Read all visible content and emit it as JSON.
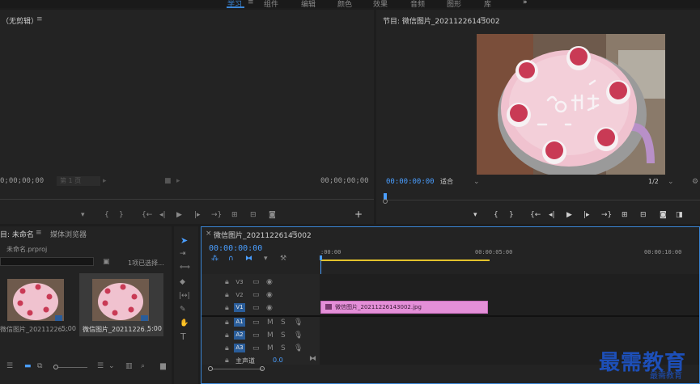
{
  "workspace": {
    "tabs": [
      {
        "label": "学习",
        "active": true
      },
      {
        "label": "组件",
        "active": false
      },
      {
        "label": "编辑",
        "active": false
      },
      {
        "label": "颜色",
        "active": false
      },
      {
        "label": "效果",
        "active": false
      },
      {
        "label": "音频",
        "active": false
      },
      {
        "label": "图形",
        "active": false
      },
      {
        "label": "库",
        "active": false
      }
    ],
    "menu_icon": "≡",
    "more_icon": "»"
  },
  "source_monitor": {
    "title": "（无剪辑）",
    "menu_icon": "≡",
    "timecode_left": "0;00;00;00",
    "timecode_right": "00;00;00;00",
    "fit_label": "第 1 页"
  },
  "program_monitor": {
    "title": "节目: 微信图片_20211226143002",
    "menu_icon": "≡",
    "timecode": "00:00:00:00",
    "fit": "适合",
    "resolution": "1/2"
  },
  "project": {
    "tab_active": "目: 未命名",
    "tab_inactive": "媒体浏览器",
    "menu_icon": "≡",
    "file": "未命名.prproj",
    "selection": "1项已选择...",
    "items": [
      {
        "name": "微信图片_20211226...",
        "duration": "5:00"
      },
      {
        "name": "微信图片_20211226...",
        "duration": "5:00"
      }
    ]
  },
  "timeline": {
    "close_icon": "×",
    "title": "微信图片_20211226143002",
    "menu_icon": "≡",
    "timecode": "00:00:00:00",
    "ruler": [
      ":00:00",
      "00:00:05:00",
      "00:00:10:00"
    ],
    "video_tracks": [
      "V3",
      "V2",
      "V1"
    ],
    "audio_tracks": [
      "A1",
      "A2",
      "A3"
    ],
    "mute": "M",
    "solo": "S",
    "master_label": "主声道",
    "master_value": "0.0",
    "clip_name": "微信图片_20211226143002.jpg"
  },
  "watermark": {
    "main": "最需教育",
    "sub": "最需教育"
  },
  "colors": {
    "accent": "#4a9eff",
    "clip": "#e48fd8",
    "work_area": "#e3c22c",
    "track_target": "#2a5d9a"
  }
}
